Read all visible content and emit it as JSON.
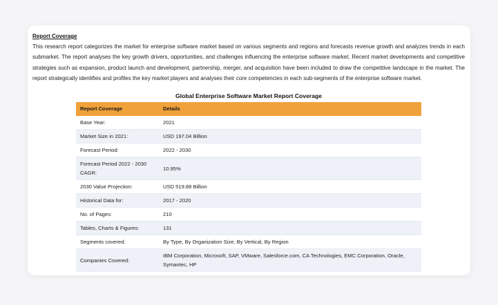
{
  "section_heading": "Report Coverage",
  "intro_text": "This research report categorizes the market for enterprise software market based on various segments and regions and forecasts revenue growth and analyzes trends in each submarket. The report analyses the key growth drivers, opportunities, and challenges influencing the enterprise software market. Recent market developments and competitive strategies such as expansion, product launch and development, partnership, merger, and acquisition have been included to draw the competitive landscape in the market. The report strategically identifies and profiles the key market players and analyses their core competencies in each sub-segments of the enterprise software market.",
  "table_title": "Global Enterprise Software Market Report Coverage",
  "table": {
    "headers": [
      "Report Coverage",
      "Details"
    ],
    "rows": [
      [
        "Base Year:",
        "2021"
      ],
      [
        "Market Size in 2021:",
        "USD 197.04 Billion"
      ],
      [
        "Forecast Period:",
        "2022 - 2030"
      ],
      [
        "Forecast Period 2022 - 2030 CAGR:",
        "10.95%"
      ],
      [
        "2030 Value Projection:",
        "USD 519.88 Billion"
      ],
      [
        "Historical Data for:",
        "2017 - 2020"
      ],
      [
        "No. of Pages:",
        "210"
      ],
      [
        "Tables, Charts & Figures:",
        "131"
      ],
      [
        "Segments covered:",
        "By Type, By Organization Size, By Vertical, By Region"
      ],
      [
        "Companies Covered:",
        "IBM Corporation, Microsoft, SAP, VMware, Salesforce.com, CA Technologies, EMC Corporation, Oracle, Symantec, HP"
      ]
    ]
  },
  "colors": {
    "header_bg": "#f0a13a",
    "alt_row_bg": "#eef2f8"
  }
}
